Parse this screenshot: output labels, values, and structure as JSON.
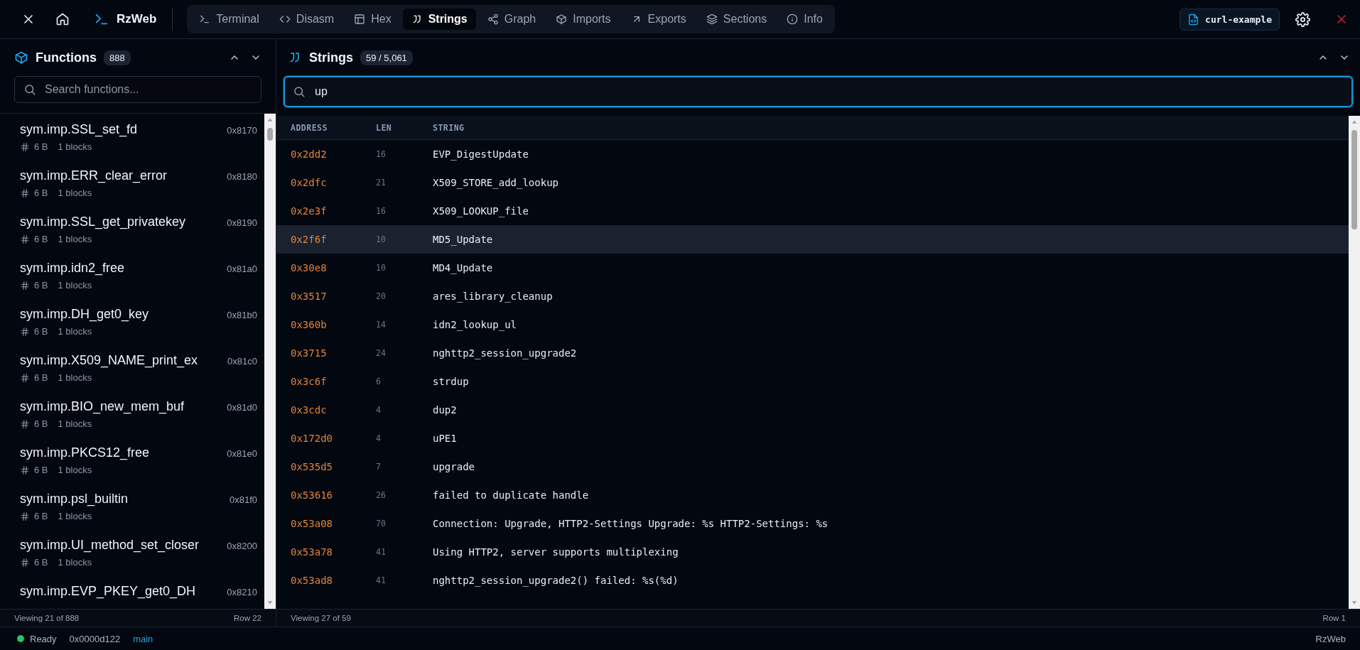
{
  "topbar": {
    "app_name": "RzWeb",
    "tabs": [
      {
        "label": "Terminal",
        "selected": false
      },
      {
        "label": "Disasm",
        "selected": false
      },
      {
        "label": "Hex",
        "selected": false
      },
      {
        "label": "Strings",
        "selected": true
      },
      {
        "label": "Graph",
        "selected": false
      },
      {
        "label": "Imports",
        "selected": false
      },
      {
        "label": "Exports",
        "selected": false
      },
      {
        "label": "Sections",
        "selected": false
      },
      {
        "label": "Info",
        "selected": false
      }
    ],
    "file_name": "curl-example"
  },
  "functions": {
    "title": "Functions",
    "count": "888",
    "search": {
      "placeholder": "Search functions..."
    },
    "items": [
      {
        "name": "sym.imp.SSL_set_fd",
        "address": "0x8170",
        "size": "6 B",
        "blocks": "1 blocks"
      },
      {
        "name": "sym.imp.ERR_clear_error",
        "address": "0x8180",
        "size": "6 B",
        "blocks": "1 blocks"
      },
      {
        "name": "sym.imp.SSL_get_privatekey",
        "address": "0x8190",
        "size": "6 B",
        "blocks": "1 blocks"
      },
      {
        "name": "sym.imp.idn2_free",
        "address": "0x81a0",
        "size": "6 B",
        "blocks": "1 blocks"
      },
      {
        "name": "sym.imp.DH_get0_key",
        "address": "0x81b0",
        "size": "6 B",
        "blocks": "1 blocks"
      },
      {
        "name": "sym.imp.X509_NAME_print_ex",
        "address": "0x81c0",
        "size": "6 B",
        "blocks": "1 blocks"
      },
      {
        "name": "sym.imp.BIO_new_mem_buf",
        "address": "0x81d0",
        "size": "6 B",
        "blocks": "1 blocks"
      },
      {
        "name": "sym.imp.PKCS12_free",
        "address": "0x81e0",
        "size": "6 B",
        "blocks": "1 blocks"
      },
      {
        "name": "sym.imp.psl_builtin",
        "address": "0x81f0",
        "size": "6 B",
        "blocks": "1 blocks"
      },
      {
        "name": "sym.imp.UI_method_set_closer",
        "address": "0x8200",
        "size": "6 B",
        "blocks": "1 blocks"
      },
      {
        "name": "sym.imp.EVP_PKEY_get0_DH",
        "address": "0x8210"
      }
    ],
    "footer": {
      "viewing": "Viewing 21 of 888",
      "row": "Row 22"
    }
  },
  "strings": {
    "title": "Strings",
    "count": "59 / 5,061",
    "search": {
      "value": "up"
    },
    "columns": [
      "ADDRESS",
      "LEN",
      "STRING"
    ],
    "rows": [
      {
        "address": "0x2dd2",
        "len": "16",
        "string": "EVP_DigestUpdate",
        "selected": false
      },
      {
        "address": "0x2dfc",
        "len": "21",
        "string": "X509_STORE_add_lookup",
        "selected": false
      },
      {
        "address": "0x2e3f",
        "len": "16",
        "string": "X509_LOOKUP_file",
        "selected": false
      },
      {
        "address": "0x2f6f",
        "len": "10",
        "string": "MD5_Update",
        "selected": true
      },
      {
        "address": "0x30e8",
        "len": "10",
        "string": "MD4_Update",
        "selected": false
      },
      {
        "address": "0x3517",
        "len": "20",
        "string": "ares_library_cleanup",
        "selected": false
      },
      {
        "address": "0x360b",
        "len": "14",
        "string": "idn2_lookup_ul",
        "selected": false
      },
      {
        "address": "0x3715",
        "len": "24",
        "string": "nghttp2_session_upgrade2",
        "selected": false
      },
      {
        "address": "0x3c6f",
        "len": "6",
        "string": "strdup",
        "selected": false
      },
      {
        "address": "0x3cdc",
        "len": "4",
        "string": "dup2",
        "selected": false
      },
      {
        "address": "0x172d0",
        "len": "4",
        "string": "uPE1",
        "selected": false
      },
      {
        "address": "0x535d5",
        "len": "7",
        "string": "upgrade",
        "selected": false
      },
      {
        "address": "0x53616",
        "len": "26",
        "string": "failed to duplicate handle",
        "selected": false
      },
      {
        "address": "0x53a08",
        "len": "70",
        "string": "Connection: Upgrade, HTTP2-Settings Upgrade: %s HTTP2-Settings: %s",
        "selected": false
      },
      {
        "address": "0x53a78",
        "len": "41",
        "string": "Using HTTP2, server supports multiplexing",
        "selected": false
      },
      {
        "address": "0x53ad8",
        "len": "41",
        "string": "nghttp2_session_upgrade2() failed: %s(%d)",
        "selected": false
      }
    ],
    "footer": {
      "viewing": "Viewing 27 of 59",
      "row": "Row 1"
    }
  },
  "status_bar": {
    "state": "Ready",
    "address": "0x0000d122",
    "branch": "main",
    "app": "RzWeb"
  }
}
